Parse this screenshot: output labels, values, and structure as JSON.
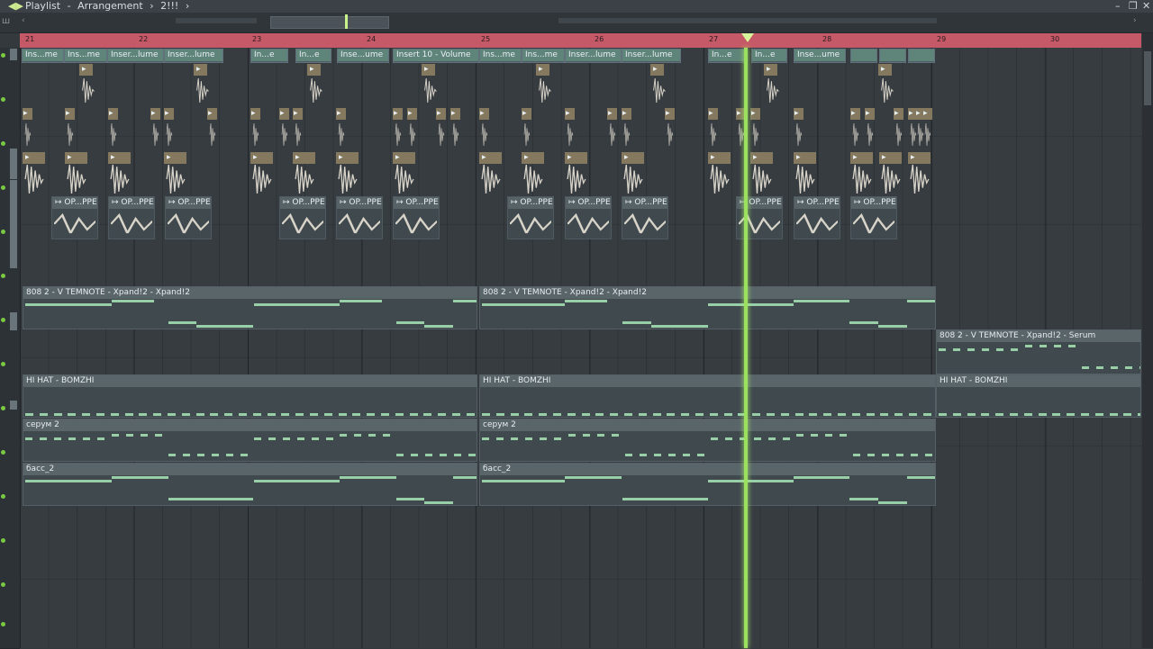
{
  "window": {
    "title": "Playlist",
    "separator": "-",
    "mode": "Arrangement",
    "arrow": "›",
    "arrangement": "2!!!",
    "arrow_after": "›",
    "minimize": "–",
    "restore": "❐",
    "close": "✕"
  },
  "ruler": {
    "bars": [
      "21",
      "22",
      "23",
      "24",
      "25",
      "26",
      "27",
      "28",
      "29",
      "30"
    ]
  },
  "colors": {
    "ruler": "#c55967",
    "playhead": "#9be05f",
    "note": "#98cfa7",
    "clip_header": "#6b7c7f"
  },
  "tracks": {
    "automation_labels": [
      "Ins...me",
      "Ins...me",
      "Inser...lume",
      "Inser...lume",
      "In...e",
      "In...e",
      "Inse...ume",
      "Insert 10 - Volume",
      "Ins...me",
      "Ins...me",
      "Inser...lume",
      "Inser...lume",
      "In...e",
      "In...e",
      "Inse...ume"
    ],
    "chopper_label": "OP...PPER",
    "pattern_808": "808 2 - V TEMNOTE - Xpand!2 - Xpand!2",
    "pattern_808_serum": "808 2 - V TEMNOTE - Xpand!2 - Serum",
    "pattern_hihat": "HI HAT - BOMZHI",
    "pattern_serum": "серум 2",
    "pattern_bass": "басс_2"
  }
}
